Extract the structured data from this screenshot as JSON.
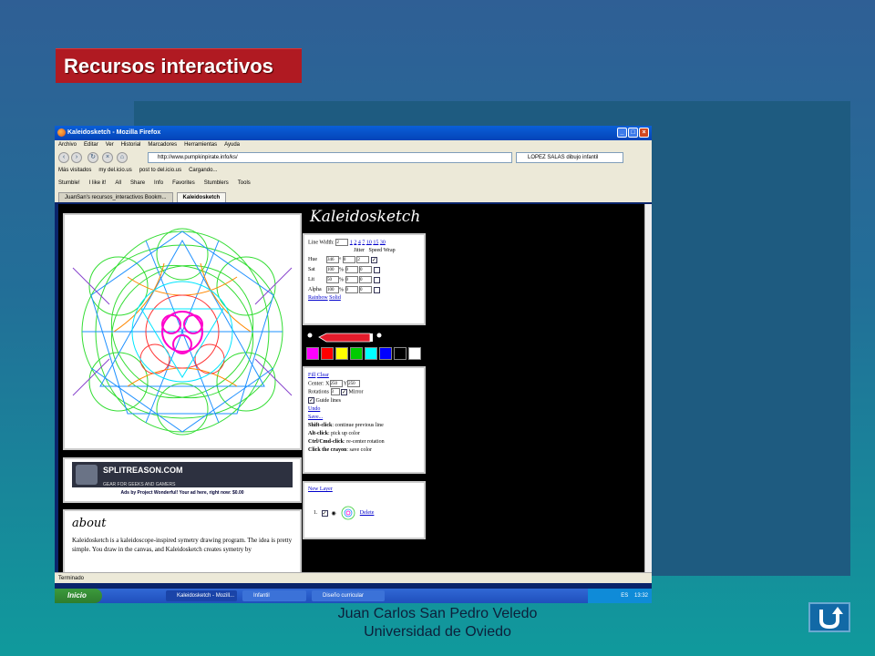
{
  "slide": {
    "title": "Recursos interactivos",
    "footer_line1": "Juan Carlos San Pedro Veledo",
    "footer_line2": "Universidad de Oviedo",
    "accent_color": "#b01a22"
  },
  "browser": {
    "window_title": "Kaleidosketch - Mozilla Firefox",
    "menu": [
      "Archivo",
      "Editar",
      "Ver",
      "Historial",
      "Marcadores",
      "Herramientas",
      "Ayuda"
    ],
    "url": "http://www.pumpkinpirate.info/ks/",
    "search": "LOPEZ SALAS dibujo infantil",
    "bookmarks": [
      "Más visitados",
      "my del.icio.us",
      "post to del.icio.us",
      "Cargando..."
    ],
    "stumble_items": [
      "Stumble!",
      "I like it!",
      "All",
      "Share",
      "Info",
      "Favorites",
      "Stumblers",
      "Tools"
    ],
    "tabs": [
      "JuanSan's recursos_interactivos Bookm...",
      "Kaleidosketch"
    ],
    "status": "Terminado"
  },
  "kaleido": {
    "logo": "Kaleidosketch",
    "line_width_label": "Line Width:",
    "line_width_value": "2",
    "widths": [
      "1",
      "2",
      "4",
      "7",
      "10",
      "15",
      "30"
    ],
    "jitter_label": "Jitter",
    "speed_label": "Speed",
    "wrap_label": "Wrap",
    "rows": [
      {
        "label": "Hue",
        "value": "346",
        "unit": "°",
        "jitter": "0",
        "speed": "2",
        "wrap": true
      },
      {
        "label": "Sat",
        "value": "100",
        "unit": "%",
        "jitter": "0",
        "speed": "0",
        "wrap": false
      },
      {
        "label": "Lit",
        "value": "50",
        "unit": "%",
        "jitter": "0",
        "speed": "0",
        "wrap": false
      },
      {
        "label": "Alpha",
        "value": "100",
        "unit": "%",
        "jitter": "0",
        "speed": "0",
        "wrap": false
      }
    ],
    "rainbow": "Rainbow",
    "solid": "Solid",
    "swatches": [
      "#ff00ff",
      "#ff0000",
      "#ffff00",
      "#00cc00",
      "#00ffff",
      "#0000ff",
      "#000000",
      "#ffffff"
    ],
    "fill": "Fill",
    "clear": "Clear",
    "center_label": "Center:",
    "center_x": "250",
    "center_y": "250",
    "rotations_label": "Rotations",
    "rotations_value": "3",
    "mirror_label": "Mirror",
    "guide_lines": "Guide lines",
    "undo": "Undo",
    "save": "Save...",
    "tips": [
      {
        "key": "Shift-click",
        "text": ": continue previous line"
      },
      {
        "key": "Alt-click",
        "text": ": pick up color"
      },
      {
        "key": "Ctrl/Cmd-click",
        "text": ": re-center rotation"
      },
      {
        "key": "Click the crayon",
        "text": ": save color"
      }
    ],
    "new_layer": "New Layer",
    "layer_number": "1.",
    "delete": "Delete",
    "ad_brand": "SPLITREASON.COM",
    "ad_tagline": "GEAR FOR GEEKS AND GAMERS",
    "ad_text": "Ads by Project Wonderful! Your ad here, right now: $0.00",
    "about_title": "about",
    "about_text": "Kaleidosketch is a kaleidoscope-inspired symetry drawing program. The idea is pretty simple. You draw in the canvas, and Kaleidosketch creates symetry by"
  },
  "taskbar": {
    "start": "Inicio",
    "tasks": [
      "Kaleidosketch - Mozill...",
      "Infantil",
      "Diseño curricular"
    ],
    "lang": "ES",
    "clock": "13:32"
  }
}
